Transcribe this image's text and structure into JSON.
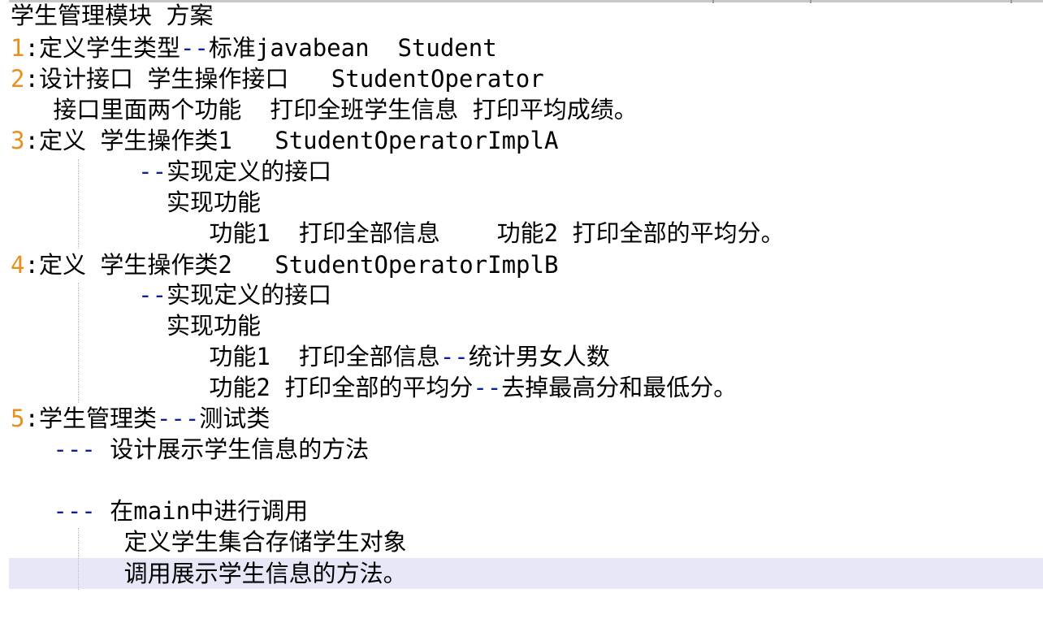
{
  "editor": {
    "lines": [
      {
        "num": "",
        "sep": "",
        "pre": "学生管理模块 方案",
        "op": "",
        "post": ""
      },
      {
        "num": "1",
        "sep": ":",
        "pre": "定义学生类型",
        "op": "--",
        "post": "标准javabean  Student"
      },
      {
        "num": "2",
        "sep": ":",
        "pre": "设计接口 学生操作接口   StudentOperator",
        "op": "",
        "post": ""
      },
      {
        "num": "",
        "sep": "",
        "pre": "   接口里面两个功能  打印全班学生信息 打印平均成绩。",
        "op": "",
        "post": ""
      },
      {
        "num": "3",
        "sep": ":",
        "pre": "定义 学生操作类1   StudentOperatorImplA",
        "op": "",
        "post": ""
      },
      {
        "num": "",
        "sep": "",
        "pre": "         ",
        "op": "--",
        "post": "实现定义的接口"
      },
      {
        "num": "",
        "sep": "",
        "pre": "           实现功能",
        "op": "",
        "post": ""
      },
      {
        "num": "",
        "sep": "",
        "pre": "              功能1  打印全部信息    功能2 打印全部的平均分。",
        "op": "",
        "post": ""
      },
      {
        "num": "4",
        "sep": ":",
        "pre": "定义 学生操作类2   StudentOperatorImplB",
        "op": "",
        "post": ""
      },
      {
        "num": "",
        "sep": "",
        "pre": "         ",
        "op": "--",
        "post": "实现定义的接口"
      },
      {
        "num": "",
        "sep": "",
        "pre": "           实现功能",
        "op": "",
        "post": ""
      },
      {
        "num": "",
        "sep": "",
        "pre": "              功能1  打印全部信息",
        "op": "--",
        "post": "统计男女人数"
      },
      {
        "num": "",
        "sep": "",
        "pre": "              功能2 打印全部的平均分",
        "op": "--",
        "post": "去掉最高分和最低分。"
      },
      {
        "num": "5",
        "sep": ":",
        "pre": "学生管理类",
        "op": "---",
        "post": "测试类"
      },
      {
        "num": "",
        "sep": "",
        "pre": "   ",
        "op": "---",
        "post": " 设计展示学生信息的方法"
      },
      {
        "num": "",
        "sep": "",
        "pre": "",
        "op": "",
        "post": ""
      },
      {
        "num": "",
        "sep": "",
        "pre": "   ",
        "op": "---",
        "post": " 在main中进行调用"
      },
      {
        "num": "",
        "sep": "",
        "pre": "        定义学生集合存储学生对象",
        "op": "",
        "post": ""
      },
      {
        "num": "",
        "sep": "",
        "pre": "        调用展示学生信息的方法。",
        "op": "",
        "post": ""
      }
    ]
  },
  "colors": {
    "line_number": "#e8901f",
    "operator": "#0f1f8f",
    "current_line_highlight": "#e7e7f8"
  }
}
